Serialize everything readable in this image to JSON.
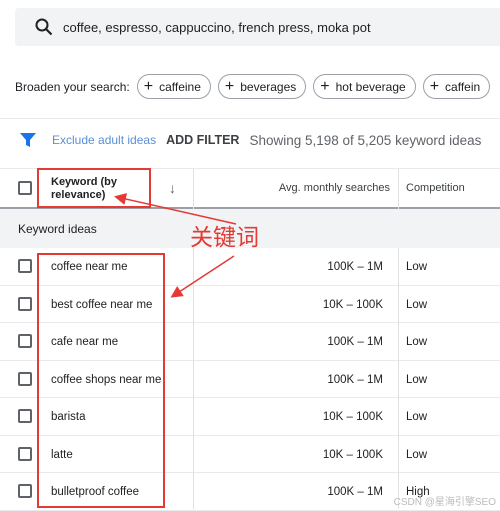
{
  "search": {
    "query": "coffee, espresso, cappuccino, french press, moka pot",
    "icon": "search-icon"
  },
  "broaden": {
    "label": "Broaden your search:",
    "chips": [
      "caffeine",
      "beverages",
      "hot beverage",
      "caffein"
    ]
  },
  "filter": {
    "exclude": "Exclude adult ideas",
    "add": "ADD FILTER",
    "showing": "Showing 5,198 of 5,205 keyword ideas"
  },
  "table": {
    "headers": {
      "keyword": "Keyword (by relevance)",
      "searches": "Avg. monthly searches",
      "competition": "Competition"
    },
    "group": "Keyword ideas",
    "rows": [
      {
        "keyword": "coffee near me",
        "searches": "100K – 1M",
        "competition": "Low"
      },
      {
        "keyword": "best coffee near me",
        "searches": "10K – 100K",
        "competition": "Low"
      },
      {
        "keyword": "cafe near me",
        "searches": "100K – 1M",
        "competition": "Low"
      },
      {
        "keyword": "coffee shops near me",
        "searches": "100K – 1M",
        "competition": "Low"
      },
      {
        "keyword": "barista",
        "searches": "10K – 100K",
        "competition": "Low"
      },
      {
        "keyword": "latte",
        "searches": "10K – 100K",
        "competition": "Low"
      },
      {
        "keyword": "bulletproof coffee",
        "searches": "100K – 1M",
        "competition": "High"
      }
    ]
  },
  "annotation": {
    "label": "关键词",
    "color": "#e53935"
  },
  "watermark": "CSDN @星海引擎SEO",
  "colors": {
    "accent": "#1a73e8",
    "link": "#5b8fd6"
  }
}
